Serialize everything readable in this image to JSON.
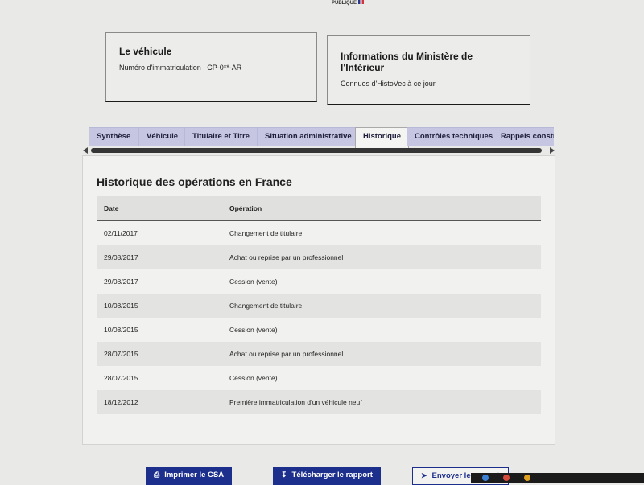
{
  "logo": {
    "text": "PUBLIQUE"
  },
  "vehicle_card": {
    "title": "Le véhicule",
    "plate_line": "Numéro d'immatriculation : CP-0**-AR"
  },
  "ministry_card": {
    "title": "Informations du Ministère de l'Intérieur",
    "subtitle": "Connues d'HistoVec à ce jour"
  },
  "tabs": [
    {
      "label": "Synthèse"
    },
    {
      "label": "Véhicule"
    },
    {
      "label": "Titulaire et Titre"
    },
    {
      "label": "Situation administrative"
    },
    {
      "label": "Historique"
    },
    {
      "label": "Contrôles techniques"
    },
    {
      "label": "Rappels constructeur"
    }
  ],
  "active_tab": "Historique",
  "history": {
    "title": "Historique des opérations en France",
    "columns": [
      "Date",
      "Opération"
    ],
    "rows": [
      {
        "date": "02/11/2017",
        "operation": "Changement de titulaire"
      },
      {
        "date": "29/08/2017",
        "operation": "Achat ou reprise par un professionnel"
      },
      {
        "date": "29/08/2017",
        "operation": "Cession (vente)"
      },
      {
        "date": "10/08/2015",
        "operation": "Changement de titulaire"
      },
      {
        "date": "10/08/2015",
        "operation": "Cession (vente)"
      },
      {
        "date": "28/07/2015",
        "operation": "Achat ou reprise par un professionnel"
      },
      {
        "date": "28/07/2015",
        "operation": "Cession (vente)"
      },
      {
        "date": "18/12/2012",
        "operation": "Première immatriculation d'un véhicule neuf"
      }
    ]
  },
  "actions": {
    "print_label": "Imprimer le CSA",
    "download_label": "Télécharger le rapport",
    "send_label": "Envoyer le rapport"
  },
  "colors": {
    "primary": "#1d2f8c",
    "tab_bg": "#c6c6e2",
    "page_bg": "#e9eae7"
  }
}
